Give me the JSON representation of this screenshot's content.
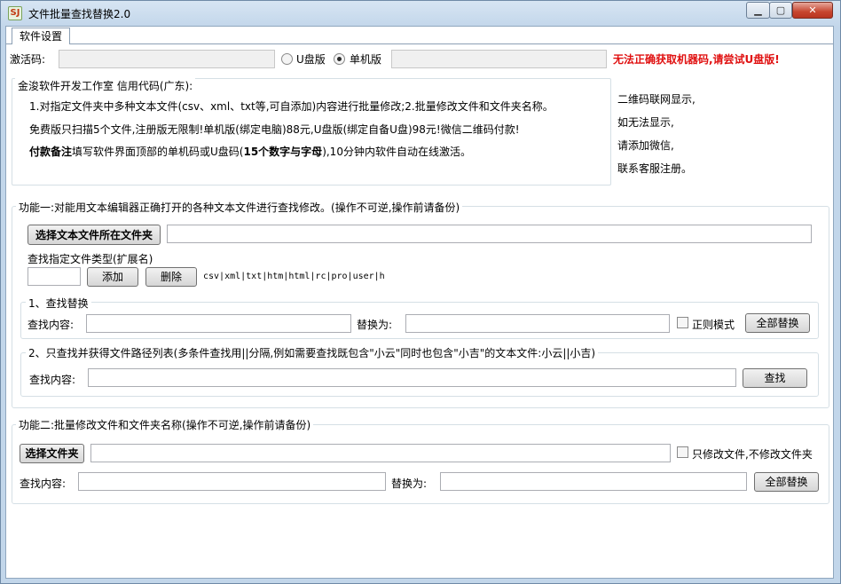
{
  "window": {
    "title": "文件批量查找替换2.0",
    "icon_label": "SJ",
    "min_label": "▁",
    "max_label": "▢",
    "close_label": "✕"
  },
  "tabs": [
    {
      "label": "软件设置"
    }
  ],
  "activation": {
    "label": "激活码:",
    "code_value": "",
    "radio_usb_label": "U盘版",
    "radio_standalone_label": "单机版",
    "selected": "单机版",
    "machine_code_value": "",
    "warning": "无法正确获取机器码,请尝试U盘版!"
  },
  "info": {
    "legend": "金浚软件开发工作室 信用代码(广东):",
    "line1": "1.对指定文件夹中多种文本文件(csv、xml、txt等,可自添加)内容进行批量修改;2.批量修改文件和文件夹名称。",
    "line2": "免费版只扫描5个文件,注册版无限制!单机版(绑定电脑)88元,U盘版(绑定自备U盘)98元!微信二维码付款!",
    "line3_bold": "付款备注",
    "line3_a": "填写软件界面顶部的单机码或U盘码(",
    "line3_bold2": "15个数字与字母",
    "line3_b": "),10分钟内软件自动在线激活。"
  },
  "qr_note": {
    "line1": "二维码联网显示,",
    "line2": "如无法显示,",
    "line3": "请添加微信,",
    "line4": "联系客服注册。"
  },
  "func1": {
    "legend": "功能一:对能用文本编辑器正确打开的各种文本文件进行查找修改。(操作不可逆,操作前请备份)",
    "choose_folder_label": "选择文本文件所在文件夹",
    "folder_path_value": "",
    "ext_label": "查找指定文件类型(扩展名)",
    "ext_input_value": "",
    "add_label": "添加",
    "delete_label": "删除",
    "ext_list": "csv|xml|txt|htm|html|rc|pro|user|h",
    "replace_group": {
      "legend": "1、查找替换",
      "find_label": "查找内容:",
      "find_value": "",
      "replace_label": "替换为:",
      "replace_value": "",
      "regex_label": "正则模式",
      "regex_checked": false,
      "replace_all_label": "全部替换"
    },
    "search_group": {
      "legend": "2、只查找并获得文件路径列表(多条件查找用||分隔,例如需要查找既包含\"小云\"同时也包含\"小吉\"的文本文件:小云||小吉)",
      "find_label": "查找内容:",
      "find_value": "",
      "search_label": "查找"
    }
  },
  "func2": {
    "legend": "功能二:批量修改文件和文件夹名称(操作不可逆,操作前请备份)",
    "choose_folder_label": "选择文件夹",
    "folder_path_value": "",
    "files_only_label": "只修改文件,不修改文件夹",
    "files_only_checked": false,
    "find_label": "查找内容:",
    "find_value": "",
    "replace_label": "替换为:",
    "replace_value": "",
    "replace_all_label": "全部替换"
  }
}
